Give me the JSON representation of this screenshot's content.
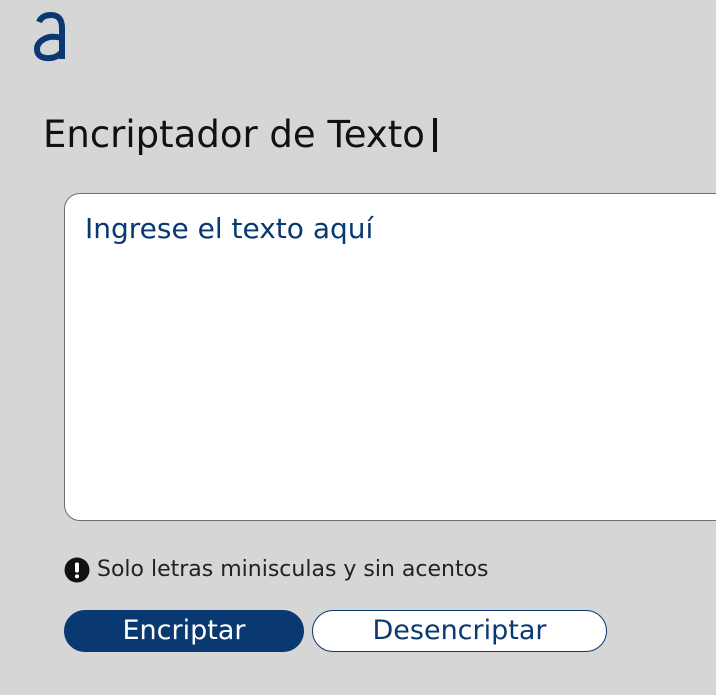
{
  "brand": {
    "icon": "alura-a-logo-icon",
    "color": "#0a3871"
  },
  "header": {
    "title": "Encriptador de Texto"
  },
  "input": {
    "placeholder": "Ingrese el texto aquí",
    "value": ""
  },
  "hint": {
    "icon": "exclamation-circle-icon",
    "text": "Solo letras miniscula​s y sin acentos"
  },
  "actions": {
    "encrypt_label": "Encriptar",
    "decrypt_label": "Desencriptar"
  },
  "colors": {
    "background": "#d6d6d6",
    "accent": "#0a3871",
    "text_dark": "#111111"
  }
}
